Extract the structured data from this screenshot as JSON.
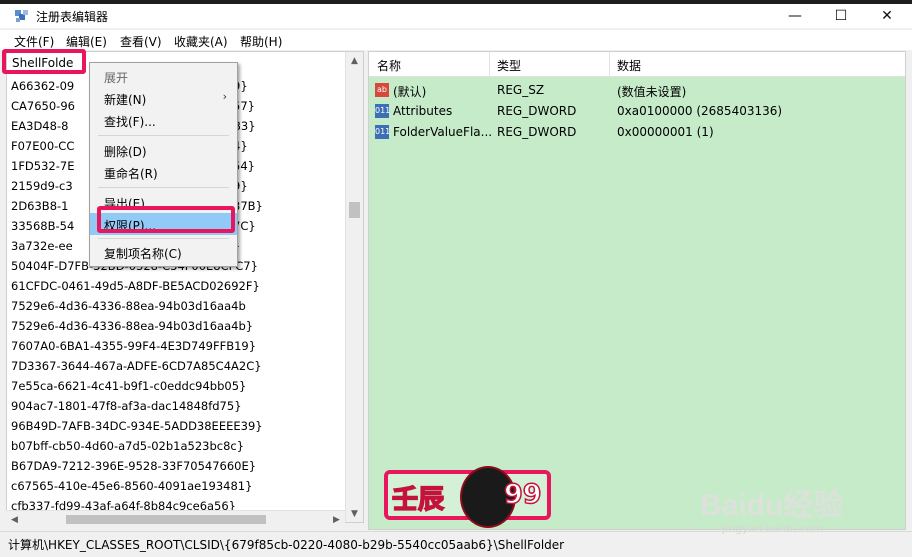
{
  "window": {
    "title": "注册表编辑器",
    "minimize": "—",
    "maximize": "☐",
    "close": "✕"
  },
  "menubar": {
    "items": [
      "文件(F)",
      "编辑(E)",
      "查看(V)",
      "收藏夹(A)",
      "帮助(H)"
    ]
  },
  "tree": {
    "selected": "ShellFolde",
    "items": [
      "A66362-09",
      "CA7650-96",
      "EA3D48-8",
      "F07E00-CC",
      "1FD532-7E",
      "2159d9-c3",
      "2D63B8-1",
      "33568B-54",
      "3a732e-ee",
      "50404F-D7FB-32BD-0328-C34F00E8CFC7}",
      "61CFDC-0461-49d5-A8DF-BE5ACD02692F}",
      "7529e6-4d36-4336-88ea-94b03d16aa4b",
      "7529e6-4d36-4336-88ea-94b03d16aa4b}",
      "7607A0-6BA1-4355-99F4-4E3D749FFB19}",
      "7D3367-3644-467a-ADFE-6CD7A85C4A2C}",
      "7e55ca-6621-4c41-b9f1-c0eddc94bb05}",
      "904ac7-1801-47f8-af3a-dac14848fd75}",
      "96B49D-7AFB-34DC-934E-5ADD38EEEE39}",
      "b07bff-cb50-4d60-a7d5-02b1a523bc8c}",
      "B67DA9-7212-396E-9528-33F70547660E}",
      "c67565-410e-45e6-8560-4091ae193481}",
      "cfb337-fd99-43af-a64f-8b84c9ce6a56}"
    ],
    "right_fragments": [
      "9}",
      "57}",
      "B3}",
      "4}",
      "54}",
      "9}",
      "37B}",
      "7C}",
      "}"
    ]
  },
  "context_menu": {
    "header": "展开",
    "new": "新建(N)",
    "find": "查找(F)...",
    "delete": "删除(D)",
    "rename": "重命名(R)",
    "export": "导出(E)",
    "permissions": "权限(P)...",
    "copy_key_name": "复制项名称(C)",
    "submenu_arrow": "›"
  },
  "list": {
    "columns": [
      "名称",
      "类型",
      "数据"
    ],
    "rows": [
      {
        "icon": "string-value-icon",
        "icon_text": "ab",
        "name": "(默认)",
        "type": "REG_SZ",
        "data": "(数值未设置)"
      },
      {
        "icon": "binary-value-icon",
        "icon_text": "011",
        "name": "Attributes",
        "type": "REG_DWORD",
        "data": "0xa0100000 (2685403136)"
      },
      {
        "icon": "binary-value-icon",
        "icon_text": "011",
        "name": "FolderValueFla...",
        "type": "REG_DWORD",
        "data": "0x00000001 (1)"
      }
    ]
  },
  "statusbar": {
    "path": "计算机\\HKEY_CLASSES_ROOT\\CLSID\\{679f85cb-0220-4080-b29b-5540cc05aab6}\\ShellFolder"
  },
  "overlay": {
    "logo_left": "壬辰",
    "logo_right": "99",
    "watermark": "Baidu经验",
    "watermark_sub": "jingyan.baidu.com"
  },
  "colors": {
    "highlight_box": "#e8175d",
    "list_background": "#c6ebc9",
    "menu_hover": "#91c9f7"
  }
}
